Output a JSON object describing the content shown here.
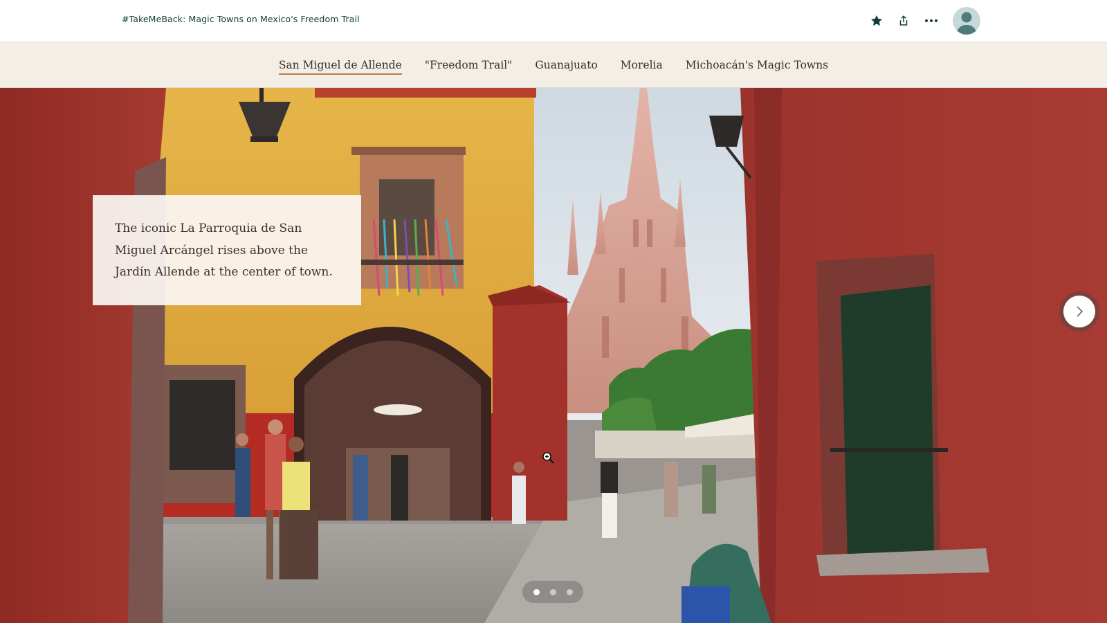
{
  "header": {
    "story_title": "#TakeMeBack: Magic Towns on Mexico's Freedom Trail",
    "icons": [
      "star-icon",
      "share-icon",
      "more-icon",
      "avatar"
    ]
  },
  "nav": {
    "items": [
      {
        "label": "San Miguel de Allende",
        "active": true
      },
      {
        "label": "\"Freedom Trail\"",
        "active": false
      },
      {
        "label": "Guanajuato",
        "active": false
      },
      {
        "label": "Morelia",
        "active": false
      },
      {
        "label": "Michoacán's Magic Towns",
        "active": false
      }
    ]
  },
  "hero": {
    "caption": "The iconic La Parroquia de San Miguel Arcángel rises above the Jardín Allende at the center of town.",
    "slides_total": 3,
    "active_slide": 1,
    "next_icon": "chevron-right-icon"
  },
  "colors": {
    "title_text": "#0d3c3a",
    "nav_background": "#f3efe6",
    "nav_active_underline": "#b57c48",
    "avatar_background": "#c6d8d9"
  }
}
